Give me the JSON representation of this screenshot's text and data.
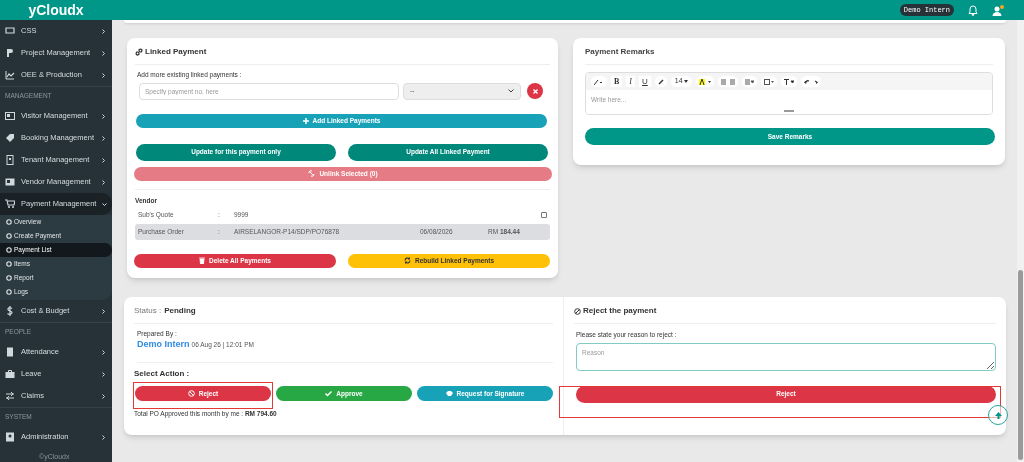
{
  "topbar": {
    "brand": "yCloudx",
    "user_badge": "Demo Intern",
    "notification_dot": true
  },
  "sidebar": {
    "sections": [
      {
        "items": [
          {
            "label": "CSS",
            "expanded": false
          },
          {
            "label": "Project Management",
            "expanded": false
          },
          {
            "label": "OEE & Production",
            "expanded": false
          }
        ]
      },
      {
        "header": "MANAGEMENT",
        "items": [
          {
            "label": "Visitor Management",
            "expanded": false
          },
          {
            "label": "Booking Management",
            "expanded": false
          },
          {
            "label": "Tenant Management",
            "expanded": false
          },
          {
            "label": "Vendor Management",
            "expanded": false
          },
          {
            "label": "Payment Management",
            "expanded": true,
            "children": [
              {
                "label": "Overview",
                "selected": false
              },
              {
                "label": "Create Payment",
                "selected": false
              },
              {
                "label": "Payment List",
                "selected": true
              },
              {
                "label": "Items",
                "selected": false
              },
              {
                "label": "Report",
                "selected": false
              },
              {
                "label": "Logs",
                "selected": false
              }
            ]
          },
          {
            "label": "Cost & Budget",
            "expanded": false
          }
        ]
      },
      {
        "header": "PEOPLE",
        "items": [
          {
            "label": "Attendance",
            "expanded": false
          },
          {
            "label": "Leave",
            "expanded": false
          },
          {
            "label": "Claims",
            "expanded": false
          }
        ]
      },
      {
        "header": "SYSTEM",
        "items": [
          {
            "label": "Administration",
            "expanded": false
          }
        ]
      }
    ],
    "footer": "©yCloudx"
  },
  "linked_payment": {
    "title": "Linked Payment",
    "add_label": "Add more existing linked payments :",
    "payment_field": {
      "placeholder": "Specify payment no. here"
    },
    "payment_select": {
      "value": "--"
    },
    "add_button": "Add Linked Payments",
    "update_buttons": [
      "Update for this payment only",
      "Update All Linked Payment"
    ],
    "unlink_button": {
      "label": "Unlink Selected (0)",
      "disabled": true
    },
    "vendor": {
      "title": "Vendor",
      "rows": [
        {
          "label": "Sub's Quote",
          "separator": ":",
          "value": "9999",
          "checked": false,
          "selected": false
        },
        {
          "label": "Purchase Order",
          "separator": ":",
          "value": "AIRSELANGOR-P14/SDP/PO76878",
          "date": "06/08/2026",
          "amount": "RM **184.44**",
          "selected": true
        }
      ]
    },
    "delete_button": "Delete All Payments",
    "rebuild_button": "Rebuild Linked Payments"
  },
  "payment_remarks": {
    "title": "Payment Remarks",
    "format_buttons": [
      "B",
      "I",
      "U"
    ],
    "font_size": "14",
    "editor": {
      "placeholder": "Write here..."
    },
    "save_button": "Save Remarks"
  },
  "status": {
    "label": "Status :",
    "value": "Pending",
    "prepared_by_label": "Prepared By :",
    "prepared_by": "Demo Intern",
    "prepared_at": "06 Aug 26 | 12:01 PM",
    "select_action": "Select Action :",
    "actions": [
      {
        "label": "Reject",
        "kind": "reject",
        "highlighted": true
      },
      {
        "label": "Approve",
        "kind": "approve",
        "highlighted": false
      },
      {
        "label": "Request for Signature",
        "kind": "signature",
        "highlighted": false
      }
    ],
    "total": "Total PO Approved this month by me : **RM 794.60**"
  },
  "reject_panel": {
    "title": "Reject the payment",
    "reason_label": "Please state your reason to reject :",
    "reason_field": {
      "placeholder": "Reason"
    },
    "reject_button": {
      "label": "Reject",
      "highlighted": true
    }
  }
}
